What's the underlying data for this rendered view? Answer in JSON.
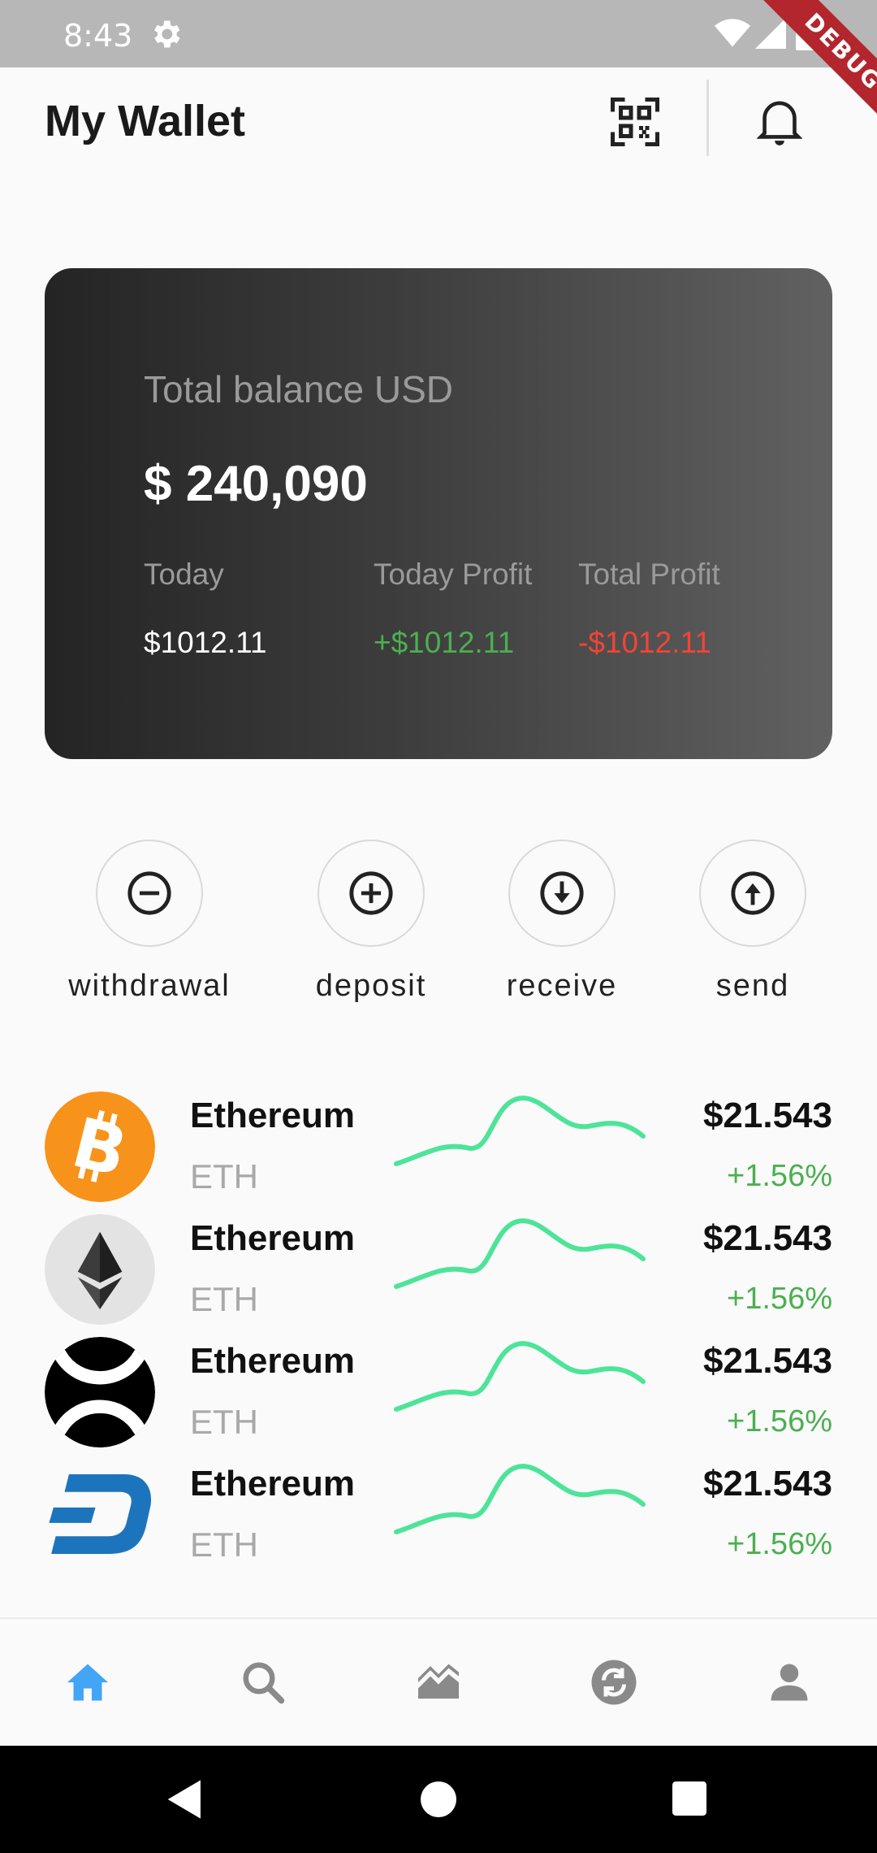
{
  "status_bar": {
    "time": "8:43",
    "debug_badge": "DEBUG"
  },
  "header": {
    "title": "My Wallet"
  },
  "balance": {
    "label": "Total balance USD",
    "amount": "$ 240,090",
    "stats": [
      {
        "label": "Today",
        "value": "$1012.11",
        "color": "#ffffff"
      },
      {
        "label": "Today Profit",
        "value": "+$1012.11",
        "color": "#4caf50"
      },
      {
        "label": "Total Profit",
        "value": "-$1012.11",
        "color": "#f44336"
      }
    ]
  },
  "actions": [
    {
      "label": "withdrawal",
      "icon": "minus-circle-icon"
    },
    {
      "label": "deposit",
      "icon": "plus-circle-icon"
    },
    {
      "label": "receive",
      "icon": "arrow-down-circle-icon"
    },
    {
      "label": "send",
      "icon": "arrow-up-circle-icon"
    }
  ],
  "coins": [
    {
      "name": "Ethereum",
      "symbol": "ETH",
      "price": "$21.543",
      "change": "+1.56%",
      "logo": "bitcoin-logo"
    },
    {
      "name": "Ethereum",
      "symbol": "ETH",
      "price": "$21.543",
      "change": "+1.56%",
      "logo": "ethereum-logo"
    },
    {
      "name": "Ethereum",
      "symbol": "ETH",
      "price": "$21.543",
      "change": "+1.56%",
      "logo": "xrp-logo"
    },
    {
      "name": "Ethereum",
      "symbol": "ETH",
      "price": "$21.543",
      "change": "+1.56%",
      "logo": "dash-logo"
    }
  ],
  "bottom_nav": [
    {
      "name": "home",
      "icon": "home-icon",
      "active": true
    },
    {
      "name": "search",
      "icon": "search-icon",
      "active": false
    },
    {
      "name": "chart",
      "icon": "chart-icon",
      "active": false
    },
    {
      "name": "exchange",
      "icon": "exchange-icon",
      "active": false
    },
    {
      "name": "profile",
      "icon": "profile-icon",
      "active": false
    }
  ],
  "colors": {
    "positive": "#4caf50",
    "negative": "#f44336",
    "sparkline": "#4de49a",
    "nav_active": "#42a5f5",
    "nav_inactive": "#8a8a8a"
  }
}
